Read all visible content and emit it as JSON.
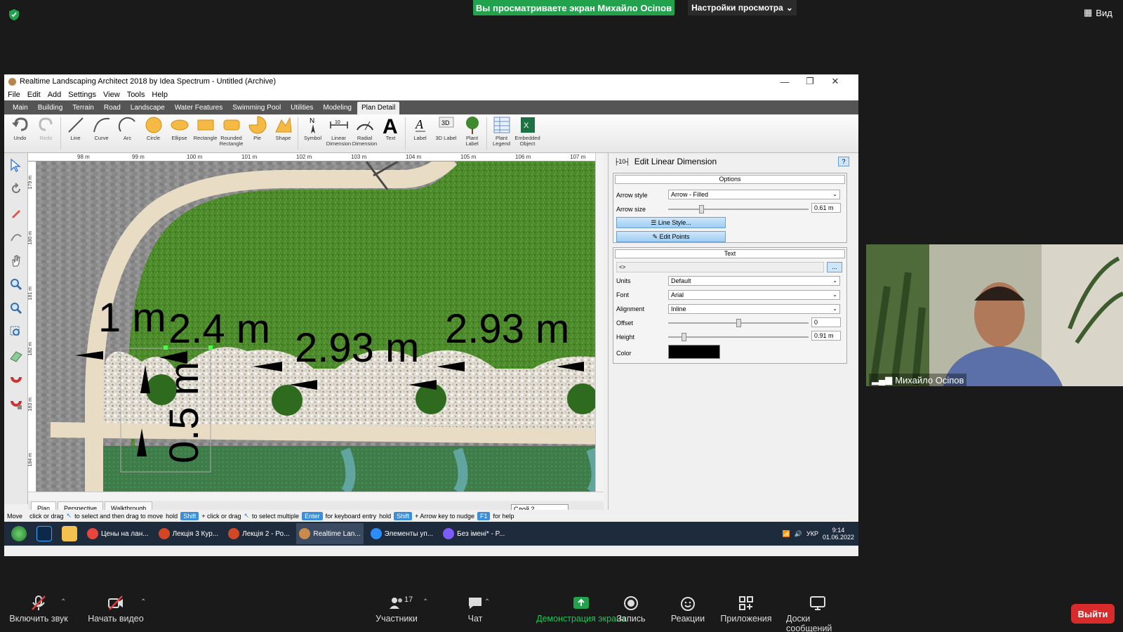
{
  "zoom": {
    "sharing_banner": "Вы просматриваете экран Михайло Осіпов",
    "view_settings": "Настройки просмотра",
    "view_button": "Вид",
    "participant_name": "Михайло Осіпов",
    "participant_count": "17",
    "toolbar": [
      {
        "id": "mute",
        "label": "Включить звук",
        "icon": "microphone-muted-icon"
      },
      {
        "id": "video",
        "label": "Начать видео",
        "icon": "camera-off-icon"
      },
      {
        "id": "participants",
        "label": "Участники",
        "icon": "participants-icon"
      },
      {
        "id": "chat",
        "label": "Чат",
        "icon": "chat-icon"
      },
      {
        "id": "share",
        "label": "Демонстрация экрана",
        "icon": "share-screen-icon"
      },
      {
        "id": "record",
        "label": "Запись",
        "icon": "record-icon"
      },
      {
        "id": "reactions",
        "label": "Реакции",
        "icon": "reactions-icon"
      },
      {
        "id": "apps",
        "label": "Приложения",
        "icon": "apps-icon"
      },
      {
        "id": "whiteboards",
        "label": "Доски сообщений",
        "icon": "whiteboard-icon"
      }
    ],
    "leave": "Выйти",
    "colors": {
      "share_green": "#23a24d",
      "leave_red": "#d92b2b"
    }
  },
  "app": {
    "title": "Realtime Landscaping Architect 2018 by Idea Spectrum - Untitled (Archive)",
    "menu": [
      "File",
      "Edit",
      "Add",
      "Settings",
      "View",
      "Tools",
      "Help"
    ],
    "ribbon_tabs": [
      "Main",
      "Building",
      "Terrain",
      "Road",
      "Landscape",
      "Water Features",
      "Swimming Pool",
      "Utilities",
      "Modeling",
      "Plan Detail"
    ],
    "active_tab": "Plan Detail",
    "tools": [
      {
        "label": "Undo",
        "icon": "undo-icon",
        "enabled": true
      },
      {
        "label": "Redo",
        "icon": "redo-icon",
        "enabled": false
      },
      {
        "label": "Line",
        "icon": "line-icon",
        "enabled": true
      },
      {
        "label": "Curve",
        "icon": "curve-icon",
        "enabled": true
      },
      {
        "label": "Arc",
        "icon": "arc-icon",
        "enabled": true
      },
      {
        "label": "Circle",
        "icon": "circle-icon",
        "enabled": true
      },
      {
        "label": "Ellipse",
        "icon": "ellipse-icon",
        "enabled": true
      },
      {
        "label": "Rectangle",
        "icon": "rectangle-icon",
        "enabled": true
      },
      {
        "label": "Rounded Rectangle",
        "icon": "rounded-rectangle-icon",
        "enabled": true
      },
      {
        "label": "Pie",
        "icon": "pie-icon",
        "enabled": true
      },
      {
        "label": "Shape",
        "icon": "shape-icon",
        "enabled": true
      },
      {
        "label": "Symbol",
        "icon": "symbol-icon",
        "enabled": true
      },
      {
        "label": "Linear Dimension",
        "icon": "linear-dimension-icon",
        "enabled": true
      },
      {
        "label": "Radial Dimension",
        "icon": "radial-dimension-icon",
        "enabled": true
      },
      {
        "label": "Text",
        "icon": "text-icon",
        "enabled": true
      },
      {
        "label": "Label",
        "icon": "label-icon",
        "enabled": true
      },
      {
        "label": "3D Label",
        "icon": "3d-label-icon",
        "enabled": true
      },
      {
        "label": "Plant Label",
        "icon": "plant-label-icon",
        "enabled": true
      },
      {
        "label": "Plant Legend",
        "icon": "plant-legend-icon",
        "enabled": true
      },
      {
        "label": "Embedded Object",
        "icon": "embedded-object-icon",
        "enabled": true
      }
    ],
    "ruler_top": [
      "98 m",
      "99 m",
      "100 m",
      "101 m",
      "102 m",
      "103 m",
      "104 m",
      "105 m",
      "106 m",
      "107 m"
    ],
    "ruler_left": [
      "179 m",
      "180 m",
      "181 m",
      "182 m",
      "183 m",
      "184 m"
    ],
    "dimensions": {
      "d1": "1 m",
      "d2": "2.4 m",
      "d3": "2.93 m",
      "d4": "2.93 m",
      "d5": "0.5 m"
    },
    "view_tabs": [
      "Plan",
      "Perspective",
      "Walkthrough"
    ],
    "layer": "Слой 2",
    "panel": {
      "title": "Edit Linear Dimension",
      "help": "?",
      "options_header": "Options",
      "arrow_style_label": "Arrow style",
      "arrow_style_value": "Arrow - Filled",
      "arrow_size_label": "Arrow size",
      "arrow_size_value": "0.61 m",
      "arrow_size_slider": 0.23,
      "line_style_btn": "Line Style...",
      "edit_points_btn": "Edit Points",
      "text_header": "Text",
      "text_value": "<>",
      "text_more_btn": "...",
      "units_label": "Units",
      "units_value": "Default",
      "font_label": "Font",
      "font_value": "Arial",
      "alignment_label": "Alignment",
      "alignment_value": "Inline",
      "offset_label": "Offset",
      "offset_value": "0",
      "offset_slider": 0.5,
      "height_label": "Height",
      "height_value": "0.91 m",
      "height_slider": 0.1,
      "color_label": "Color",
      "color_value": "#000000"
    },
    "status": {
      "mode": "Move",
      "p1": "click or drag",
      "p2": "to select and then drag to move",
      "p3": "hold",
      "k1": "Shift",
      "p4": "+ click or drag",
      "p5": "to select multiple",
      "k2": "Enter",
      "p6": "for keyboard entry",
      "p7": "hold",
      "k3": "Shift",
      "p8": "+ Arrow key to nudge",
      "k4": "F1",
      "p9": "for help"
    }
  },
  "taskbar": {
    "items": [
      {
        "label": "Цены на лан...",
        "color": "#e8453c"
      },
      {
        "label": "Лекція 3 Кур...",
        "color": "#d24726"
      },
      {
        "label": "Лекція 2 - Ро...",
        "color": "#d24726"
      },
      {
        "label": "Realtime Lan...",
        "color": "#c98a4a"
      },
      {
        "label": "Элементы уп...",
        "color": "#2d8cff"
      },
      {
        "label": "Без імені* - P...",
        "color": "#7a5cff"
      }
    ],
    "lang": "УКР",
    "time": "9:14",
    "date": "01.06.2022"
  }
}
